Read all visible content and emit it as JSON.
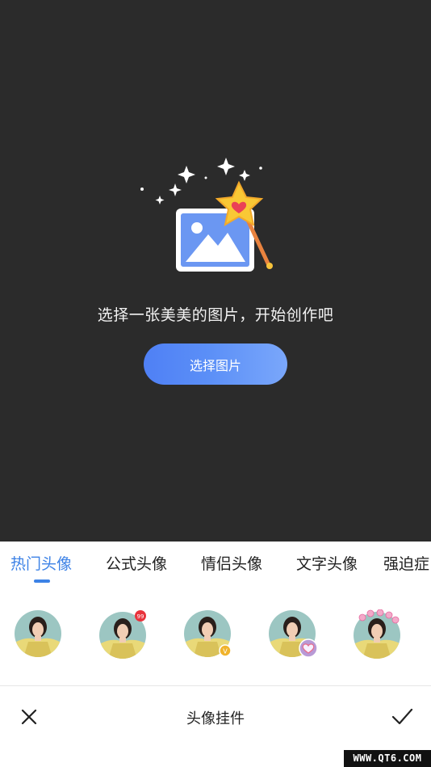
{
  "editor": {
    "prompt": "选择一张美美的图片，开始创作吧",
    "choose_button": "选择图片"
  },
  "tabs": [
    {
      "label": "热门头像",
      "active": true
    },
    {
      "label": "公式头像",
      "active": false
    },
    {
      "label": "情侣头像",
      "active": false
    },
    {
      "label": "文字头像",
      "active": false
    },
    {
      "label": "强迫症",
      "active": false
    }
  ],
  "avatars": [
    {
      "badge": "none"
    },
    {
      "badge": "99"
    },
    {
      "badge": "v-badge"
    },
    {
      "badge": "heart-badge"
    },
    {
      "badge": "cartoon-frame"
    }
  ],
  "bottom_bar": {
    "title": "头像挂件",
    "close_icon": "close-icon",
    "confirm_icon": "checkmark-icon"
  },
  "watermark": "WWW.QT6.COM",
  "colors": {
    "accent": "#3d82e6",
    "editor_bg": "#2b2b2b",
    "button_gradient_start": "#4f80f5",
    "button_gradient_end": "#7aa7fb"
  }
}
